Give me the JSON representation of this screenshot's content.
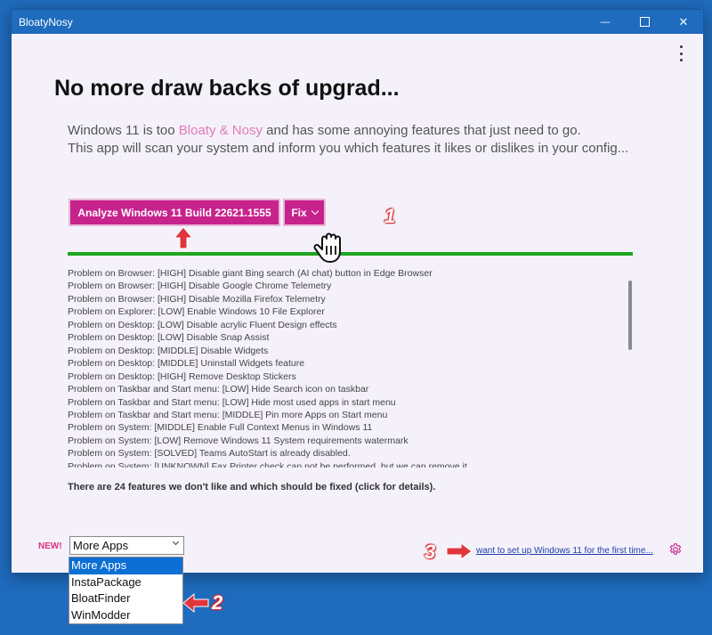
{
  "window": {
    "title": "BloatyNosy",
    "controls": {
      "minimize": "—",
      "maximize": "□",
      "close": "✕"
    },
    "menu_icon": "kebab-menu-icon"
  },
  "main": {
    "headline": "No more draw backs of upgrad...",
    "intro": {
      "line1_before": "Windows 11 is too ",
      "line1_highlight": "Bloaty & Nosy",
      "line1_after": " and has some annoying features that just need to go.",
      "line2": "This app will scan your system and inform you which features it likes or dislikes in your config..."
    },
    "analyze_button": "Analyze Windows 11 Build 22621.1555",
    "fix_button": "Fix",
    "progress_fraction": 1.0,
    "results": [
      "Problem on Browser: [HIGH] Disable giant Bing search (AI chat) button in Edge Browser",
      "Problem on Browser: [HIGH] Disable Google Chrome Telemetry",
      "Problem on Browser: [HIGH] Disable Mozilla Firefox Telemetry",
      "Problem on Explorer: [LOW] Enable Windows 10 File Explorer",
      "Problem on Desktop: [LOW] Disable acrylic Fluent Design effects",
      "Problem on Desktop: [LOW] Disable Snap Assist",
      "Problem on Desktop: [MIDDLE] Disable Widgets",
      "Problem on Desktop: [MIDDLE] Uninstall Widgets feature",
      "Problem on Desktop: [HIGH] Remove Desktop Stickers",
      "Problem on Taskbar and Start menu: [LOW] Hide Search icon on taskbar",
      "Problem on Taskbar and Start menu: [LOW] Hide most used apps in start menu",
      "Problem on Taskbar and Start menu: [MIDDLE] Pin more Apps on Start menu",
      "Problem on System: [MIDDLE] Enable Full Context Menus in Windows 11",
      "Problem on System: [LOW] Remove Windows 11 System requirements watermark",
      "Problem on System: [SOLVED] Teams AutoStart is already disabled.",
      "Problem on System: [UNKNOWN] Fax Printer check can not be performed, but we can remove it"
    ],
    "summary": "There are 24 features we don't like and which should be fixed (click for details)."
  },
  "footer": {
    "new_label": "NEW!",
    "apps_select": {
      "selected": "More Apps",
      "options": [
        "More Apps",
        "InstaPackage",
        "BloatFinder",
        "WinModder"
      ]
    },
    "setup_link": "want to set up Windows 11 for the first time...",
    "settings_icon": "gear-icon"
  },
  "annotations": {
    "step1": "1",
    "step2": "2",
    "step3": "3",
    "arrow_color": "#e0363b"
  },
  "colors": {
    "accent": "#c7238c",
    "progress": "#1fa51f",
    "titlebar": "#1f6bbd",
    "highlight": "#e07bb8"
  }
}
